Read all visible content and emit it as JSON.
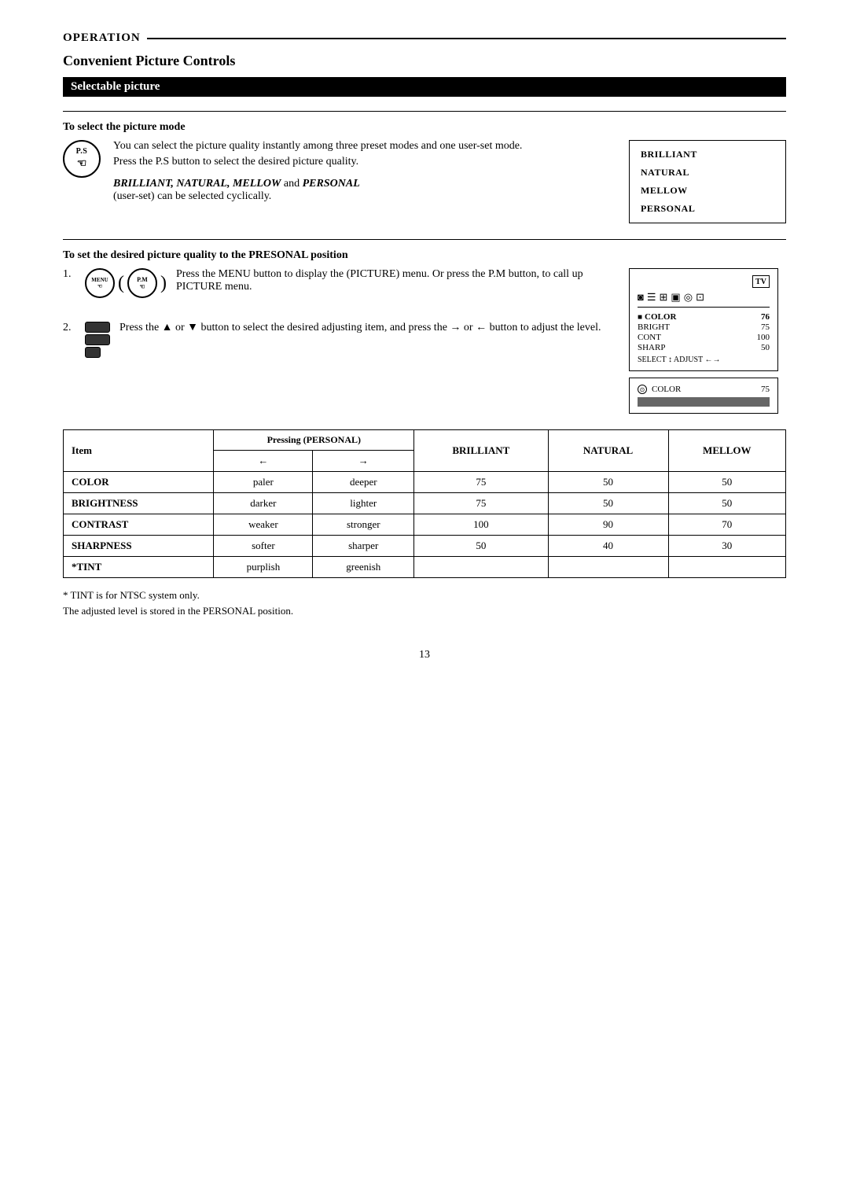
{
  "header": {
    "operation_label": "OPERATION",
    "section_title": "Convenient Picture Controls",
    "subsection": "Selectable picture"
  },
  "select_picture_mode": {
    "heading": "To select the picture mode",
    "description_1": "You can select the picture quality instantly among three preset modes and one user-set mode.",
    "description_2": "Press the P.S button to select the desired picture quality.",
    "modes_italic": "BRILLIANT, NATURAL, MELLOW",
    "modes_and": "and",
    "modes_personal": "PERSONAL",
    "modes_sub": "(user-set) can be selected cyclically.",
    "mode_list": [
      "BRILLIANT",
      "NATURAL",
      "MELLOW",
      "PERSONAL"
    ]
  },
  "presonal_section": {
    "heading": "To set the desired picture quality to the PRESONAL position",
    "step1_number": "1.",
    "step1_text": "Press the MENU button to display the (PICTURE) menu. Or press the P.M button, to call up PICTURE menu.",
    "step2_number": "2.",
    "step2_text_1": "Press the ▲ or ▼ button to select the desired adjusting item, and press the",
    "step2_arrow_right": "→",
    "step2_or": "or",
    "step2_arrow_left": "←",
    "step2_text_2": "button to adjust the level.",
    "menu_items": [
      {
        "label": "COLOR",
        "value": "76",
        "icon": "■",
        "selected": true
      },
      {
        "label": "BRIGHT",
        "value": "75"
      },
      {
        "label": "CONT",
        "value": "100"
      },
      {
        "label": "SHARP",
        "value": "50"
      }
    ],
    "select_hint": "SELECT ↕ ADJUST ←→",
    "color_bar_label": "COLOR",
    "color_bar_value": "75"
  },
  "table": {
    "caption": "Pressing (PERSONAL)",
    "col_headers": [
      "Item",
      "←",
      "→",
      "BRILLIANT",
      "NATURAL",
      "MELLOW"
    ],
    "rows": [
      {
        "item": "COLOR",
        "left": "paler",
        "right": "deeper",
        "brilliant": "75",
        "natural": "50",
        "mellow": "50"
      },
      {
        "item": "BRIGHTNESS",
        "left": "darker",
        "right": "lighter",
        "brilliant": "75",
        "natural": "50",
        "mellow": "50"
      },
      {
        "item": "CONTRAST",
        "left": "weaker",
        "right": "stronger",
        "brilliant": "100",
        "natural": "90",
        "mellow": "70"
      },
      {
        "item": "SHARPNESS",
        "left": "softer",
        "right": "sharper",
        "brilliant": "50",
        "natural": "40",
        "mellow": "30"
      },
      {
        "item": "*TINT",
        "left": "purplish",
        "right": "greenish",
        "brilliant": "",
        "natural": "",
        "mellow": ""
      }
    ]
  },
  "footnotes": [
    "* TINT is for NTSC system only.",
    "The adjusted level is stored in the PERSONAL position."
  ],
  "page_number": "13"
}
